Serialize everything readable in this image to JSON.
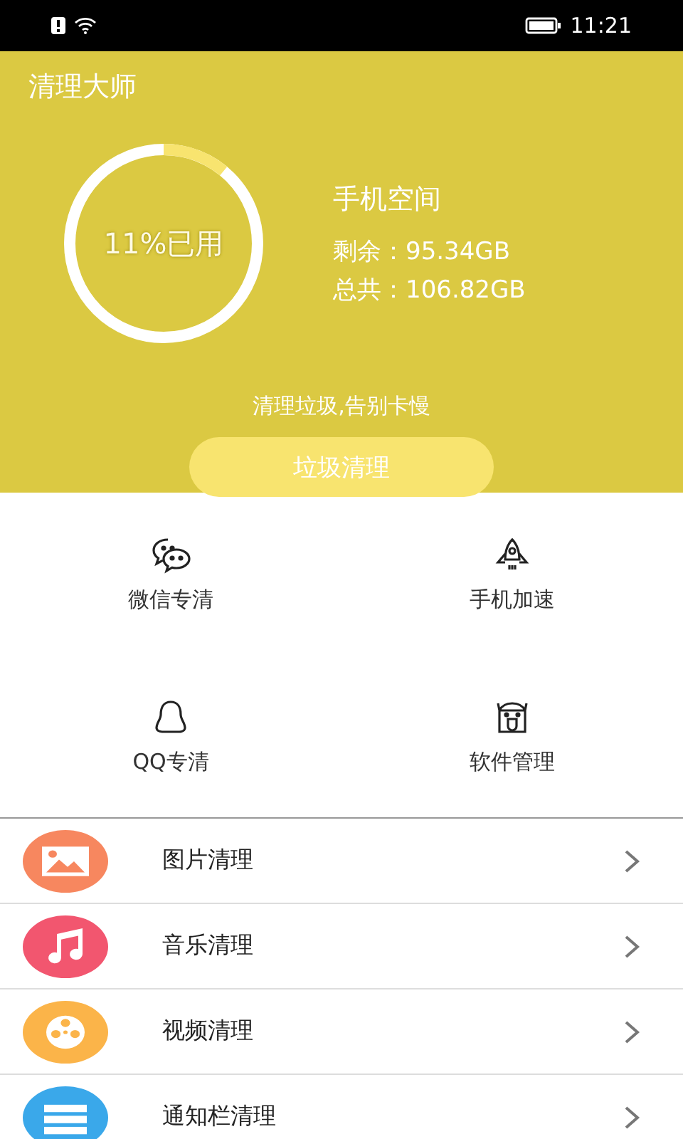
{
  "status_bar": {
    "time": "11:21"
  },
  "app_bar": {
    "title": "清理大师"
  },
  "storage": {
    "level": 0.11,
    "used_label": "11%已用",
    "heading": "手机空间",
    "remaining": "剩余：95.34GB",
    "total": "总共：106.82GB"
  },
  "slogan": "清理垃圾,告别卡慢",
  "clean_button": "垃圾清理",
  "tools": [
    {
      "kind": "chat",
      "label": "微信专清"
    },
    {
      "kind": "rocket",
      "label": "手机加速"
    },
    {
      "kind": "penguin",
      "label": "QQ专清"
    },
    {
      "kind": "robot",
      "label": "软件管理"
    }
  ],
  "list": [
    {
      "kind": "image",
      "color": "#f7875f",
      "label": "图片清理"
    },
    {
      "kind": "music",
      "color": "#f2566f",
      "label": "音乐清理"
    },
    {
      "kind": "video",
      "color": "#fbb449",
      "label": "视频清理"
    },
    {
      "kind": "notification",
      "color": "#3aa8ea",
      "label": "通知栏清理"
    }
  ]
}
